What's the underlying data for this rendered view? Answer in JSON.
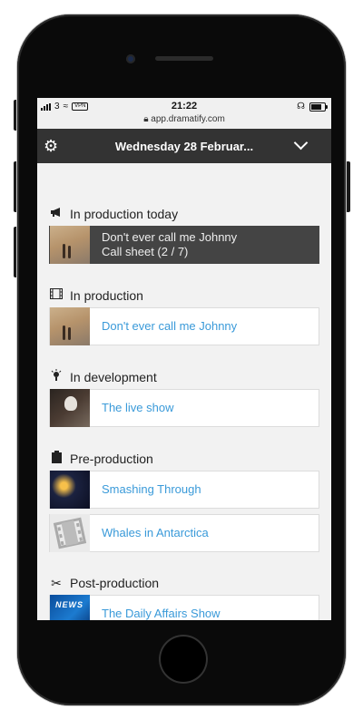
{
  "status_bar": {
    "carrier_signal": "3",
    "vpn_label": "VPN",
    "time": "21:22",
    "url": "app.dramatify.com"
  },
  "app_bar": {
    "title": "Wednesday 28 Februar..."
  },
  "sections": [
    {
      "title": "In production today",
      "icon": "megaphone-icon",
      "items": [
        {
          "title": "Don't ever call me Johnny",
          "subtitle": "Call sheet (2 / 7)",
          "thumbnail": "beach-thumbnail"
        }
      ]
    },
    {
      "title": "In production",
      "icon": "film-icon",
      "items": [
        {
          "title": "Don't ever call me Johnny",
          "thumbnail": "beach-thumbnail"
        }
      ]
    },
    {
      "title": "In development",
      "icon": "lightbulb-icon",
      "items": [
        {
          "title": "The live show",
          "thumbnail": "live-show-thumbnail"
        }
      ]
    },
    {
      "title": "Pre-production",
      "icon": "clipboard-icon",
      "items": [
        {
          "title": "Smashing Through",
          "thumbnail": "smashing-thumbnail"
        },
        {
          "title": "Whales in Antarctica",
          "thumbnail": "film-placeholder-thumbnail"
        }
      ]
    },
    {
      "title": "Post-production",
      "icon": "scissors-icon",
      "items": [
        {
          "title": "The Daily Affairs Show",
          "thumbnail": "news-thumbnail"
        }
      ]
    }
  ],
  "colors": {
    "link": "#3a9ad9",
    "app_bar_bg": "#333333",
    "highlight_card_bg": "#444444"
  }
}
